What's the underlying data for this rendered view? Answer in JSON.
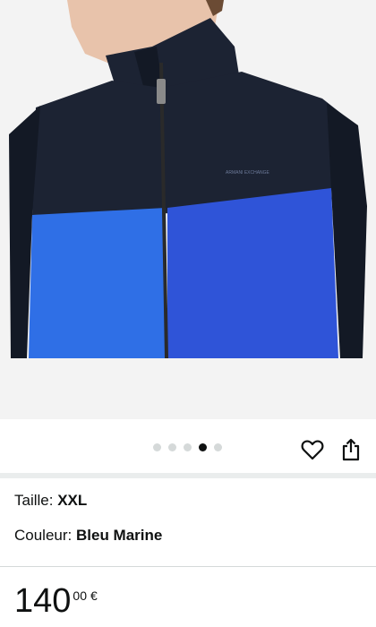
{
  "product_image": {
    "alt": "product-photo",
    "brand_print": "ARMANI EXCHANGE",
    "colors": {
      "background": "#f3f3f3",
      "navy": "#1c2333",
      "navy_dark": "#131925",
      "royal_blue": "#2f54d8",
      "bright_blue": "#2f6fe6",
      "skin": "#e8c3ab",
      "zipper": "#2a2a2a"
    }
  },
  "carousel": {
    "total": 5,
    "active_index": 3
  },
  "actions": {
    "favorite_icon": "heart-outline-icon",
    "share_icon": "share-icon"
  },
  "variations": {
    "size": {
      "label": "Taille: ",
      "value": "XXL"
    },
    "color": {
      "label": "Couleur: ",
      "value": "Bleu Marine"
    }
  },
  "price": {
    "whole": "140",
    "fraction": "00",
    "currency": "€"
  }
}
